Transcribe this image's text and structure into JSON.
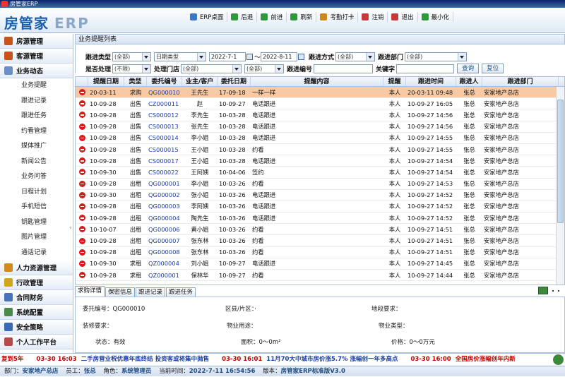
{
  "window": {
    "title": "房管家ERP"
  },
  "brand": {
    "name": "房管家",
    "suffix": "ERP"
  },
  "toolbar": [
    {
      "label": "ERP桌面",
      "icon": "desktop-icon",
      "color": "#3a78c8"
    },
    {
      "label": "后退",
      "icon": "back-icon",
      "color": "#2e9a3a"
    },
    {
      "label": "前进",
      "icon": "forward-icon",
      "color": "#2e9a3a"
    },
    {
      "label": "刷新",
      "icon": "refresh-icon",
      "color": "#2e9a3a"
    },
    {
      "label": "考勤打卡",
      "icon": "clock-icon",
      "color": "#c98a1b"
    },
    {
      "label": "注销",
      "icon": "logout-icon",
      "color": "#c83a3a"
    },
    {
      "label": "退出",
      "icon": "exit-icon",
      "color": "#c83a3a"
    },
    {
      "label": "最小化",
      "icon": "minimize-icon",
      "color": "#2e9a3a"
    }
  ],
  "sidebar": {
    "top_groups": [
      {
        "label": "房源管理",
        "icon": "house-icon",
        "color": "#c9531b"
      },
      {
        "label": "客源管理",
        "icon": "house-icon",
        "color": "#c9531b"
      },
      {
        "label": "业务动态",
        "icon": "docs-icon",
        "color": "#6b8fc7"
      }
    ],
    "items": [
      "业务提醒",
      "跟进记录",
      "跟进任务",
      "约看管理",
      "媒体推广",
      "新闻公告",
      "业务问答",
      "日程计划",
      "手机短信",
      "钥匙管理",
      "图片管理",
      "通话记录"
    ],
    "active_item": "业务提醒",
    "bottom_groups": [
      {
        "label": "人力资源管理",
        "icon": "people-icon",
        "color": "#d18a1b"
      },
      {
        "label": "行政管理",
        "icon": "folder-icon",
        "color": "#d1a61b"
      },
      {
        "label": "合同财务",
        "icon": "contract-icon",
        "color": "#4a72b8"
      },
      {
        "label": "系统配置",
        "icon": "gear-icon",
        "color": "#4a8a4a"
      },
      {
        "label": "安全策略",
        "icon": "shield-icon",
        "color": "#3a6ab8"
      },
      {
        "label": "个人工作平台",
        "icon": "person-icon",
        "color": "#b84a4a"
      }
    ]
  },
  "panel": {
    "title": "业务提醒列表"
  },
  "filters": {
    "row1": {
      "report_type_label": "跟进类型",
      "report_type_value": "(全部)",
      "date_type_value": "日期类型",
      "date_from": "2022-7-1",
      "date_sep": "～",
      "date_to": "2022-8-11",
      "method_label": "跟进方式",
      "method_value": "(全部)",
      "dept_label": "跟进部门",
      "dept_value": "(全部)"
    },
    "row2": {
      "processed_label": "是否处理",
      "processed_value": "(不限)",
      "store_label": "处理门店",
      "store_value": "(全部)",
      "store_value2": "(全部)",
      "code_label": "跟进编号",
      "code_value": "",
      "keyword_label": "关键字",
      "keyword_value": "",
      "search_button": "查询",
      "reset_button": "复位"
    }
  },
  "table": {
    "columns": [
      "提醒日期",
      "类型",
      "委托编号",
      "业主/客户",
      "委托日期",
      "提醒内容",
      "提醒",
      "跟进时间",
      "跟进人",
      "跟进部门"
    ],
    "rows": [
      [
        "20-03-11",
        "求购",
        "QG000010",
        "王先生",
        "17-09-18",
        "一样一样",
        "本人",
        "20-03-11 09:48",
        "张总",
        "安家地产总店"
      ],
      [
        "10-09-28",
        "出售",
        "CZ000011",
        "赵",
        "10-09-27",
        "电话跟进",
        "本人",
        "10-09-27 16:05",
        "张总",
        "安家地产总店"
      ],
      [
        "10-09-28",
        "出售",
        "CS000012",
        "李先生",
        "10-03-28",
        "电话跟进",
        "本人",
        "10-09-27 14:56",
        "张总",
        "安家地产总店"
      ],
      [
        "10-09-28",
        "出售",
        "CS000013",
        "张先生",
        "10-03-28",
        "电话跟进",
        "本人",
        "10-09-27 14:56",
        "张总",
        "安家地产总店"
      ],
      [
        "10-09-28",
        "出售",
        "CS000014",
        "李小姐",
        "10-03-28",
        "电话跟进",
        "本人",
        "10-09-27 14:55",
        "张总",
        "安家地产总店"
      ],
      [
        "10-09-28",
        "出售",
        "CS000015",
        "王小姐",
        "10-03-28",
        "约看",
        "本人",
        "10-09-27 14:55",
        "张总",
        "安家地产总店"
      ],
      [
        "10-09-28",
        "出售",
        "CS000017",
        "王小姐",
        "10-03-28",
        "电话跟进",
        "本人",
        "10-09-27 14:54",
        "张总",
        "安家地产总店"
      ],
      [
        "10-09-30",
        "出售",
        "CS000022",
        "王阿姨",
        "10-04-06",
        "签约",
        "本人",
        "10-09-27 14:54",
        "张总",
        "安家地产总店"
      ],
      [
        "10-09-28",
        "出租",
        "QG000001",
        "李小姐",
        "10-03-26",
        "约看",
        "本人",
        "10-09-27 14:53",
        "张总",
        "安家地产总店"
      ],
      [
        "10-09-30",
        "出租",
        "QG000002",
        "张小姐",
        "10-03-26",
        "电话跟进",
        "本人",
        "10-09-27 14:52",
        "张总",
        "安家地产总店"
      ],
      [
        "10-09-28",
        "出租",
        "QG000003",
        "李阿姨",
        "10-03-26",
        "电话跟进",
        "本人",
        "10-09-27 14:52",
        "张总",
        "安家地产总店"
      ],
      [
        "10-09-28",
        "出租",
        "QG000004",
        "陶先生",
        "10-03-26",
        "电话跟进",
        "本人",
        "10-09-27 14:52",
        "张总",
        "安家地产总店"
      ],
      [
        "10-10-07",
        "出租",
        "QG000006",
        "黄小姐",
        "10-03-26",
        "约看",
        "本人",
        "10-09-27 14:51",
        "张总",
        "安家地产总店"
      ],
      [
        "10-09-28",
        "出租",
        "QG000007",
        "张东林",
        "10-03-26",
        "约看",
        "本人",
        "10-09-27 14:51",
        "张总",
        "安家地产总店"
      ],
      [
        "10-09-28",
        "出租",
        "QG000008",
        "张东林",
        "10-03-26",
        "约看",
        "本人",
        "10-09-27 14:51",
        "张总",
        "安家地产总店"
      ],
      [
        "10-09-30",
        "求租",
        "QZ000004",
        "刘小姐",
        "10-09-27",
        "电话跟进",
        "本人",
        "10-09-27 14:45",
        "张总",
        "安家地产总店"
      ],
      [
        "10-09-28",
        "求租",
        "QZ000001",
        "保林华",
        "10-09-27",
        "约看",
        "本人",
        "10-09-27 14:44",
        "张总",
        "安家地产总店"
      ]
    ]
  },
  "tabs": [
    "求购详情",
    "保密信息",
    "跟进记录",
    "跟进任务"
  ],
  "detail": {
    "code_label": "委托编号：",
    "code_value": "QG000010",
    "district_label": "区县/片区：",
    "district_value": "·",
    "area_req_label": "地段要求：",
    "area_req_value": "",
    "decor_label": "装修要求：",
    "decor_value": "",
    "use_label": "物业用途：",
    "use_value": "",
    "ptype_label": "物业类型：",
    "ptype_value": "",
    "state_label": "状态：",
    "state_value": "有效",
    "size_label": "面积：",
    "size_value": "0～0m²",
    "price_label": "价格：",
    "price_value": "0～0万元"
  },
  "ticker": [
    {
      "date": "",
      "text": "复到5年",
      "style": "t"
    },
    {
      "date": "03-30 16:03",
      "text": "二手房营业税优惠年底终结 投资客或将集中抛售",
      "style": "n"
    },
    {
      "date": "03-30 16:01",
      "text": "11月70大中城市房价涨5.7% 涨幅创一年多高点",
      "style": "n"
    },
    {
      "date": "03-30 16:00",
      "text": "全国房价涨幅创年内新",
      "style": "t"
    }
  ],
  "status": {
    "dept_label": "部门：",
    "dept_value": "安家地产总店",
    "user_label": "员工：",
    "user_value": "张总",
    "role_label": "角色：",
    "role_value": "系统管理员",
    "time_label": "当前时间：",
    "time_value": "2022-7-11 16:54:56",
    "version_label": "版本：",
    "version_value": "房管家ERP标准版V3.0"
  }
}
